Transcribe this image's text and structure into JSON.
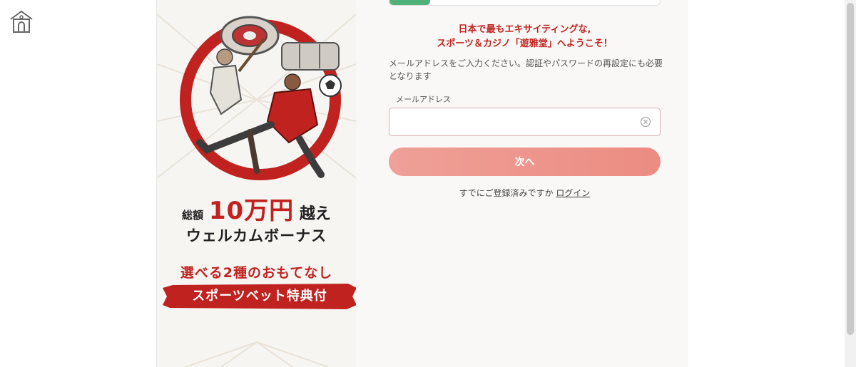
{
  "home": {
    "icon": "home-icon"
  },
  "promo": {
    "line1_prefix": "総額",
    "line1_amount": "10万円",
    "line1_suffix": "越え",
    "line2": "ウェルカムボーナス",
    "line3": "選べる2種のおもてなし",
    "banner": "スポーツベット特典付",
    "accent_color": "#c0231f"
  },
  "form": {
    "progress_fraction": 0.15,
    "welcome_line1": "日本で最もエキサイティングな,",
    "welcome_line2": "スポーツ＆カジノ「遊雅堂」へようこそ！",
    "description": "メールアドレスをご入力ください。認証やパスワードの再設定にも必要となります",
    "email_label": "メールアドレス",
    "email_value": "",
    "next_label": "次へ",
    "login_prompt": "すでにご登録済みですか",
    "login_link": "ログイン",
    "button_color": "#ec8c82"
  }
}
